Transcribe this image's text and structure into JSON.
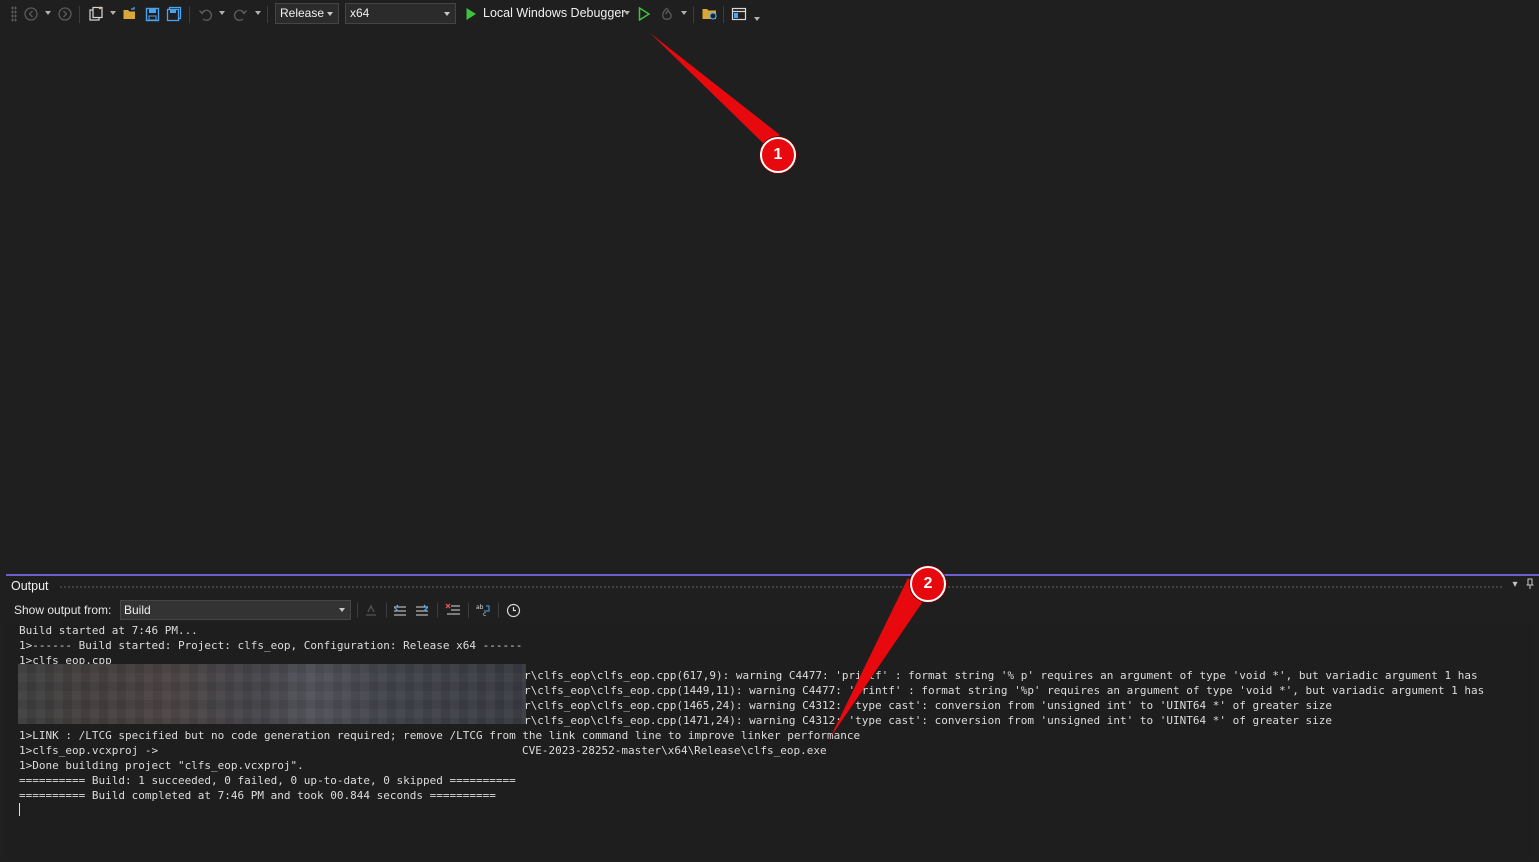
{
  "toolbar": {
    "configuration": "Release",
    "platform": "x64",
    "debugger_label": "Local Windows Debugger",
    "accent_run": "#3fc23f"
  },
  "output": {
    "title": "Output",
    "show_from_label": "Show output from:",
    "source": "Build",
    "lines": [
      "Build started at 7:46 PM...",
      "1>------ Build started: Project: clfs_eop, Configuration: Release x64 ------",
      "1>clfs_eop.cpp",
      "r\\clfs_eop\\clfs_eop.cpp(617,9): warning C4477: 'printf' : format string '% p' requires an argument of type 'void *', but variadic argument 1 has",
      "r\\clfs_eop\\clfs_eop.cpp(1449,11): warning C4477: 'printf' : format string '%p' requires an argument of type 'void *', but variadic argument 1 has",
      "r\\clfs_eop\\clfs_eop.cpp(1465,24): warning C4312: 'type cast': conversion from 'unsigned int' to 'UINT64 *' of greater size",
      "r\\clfs_eop\\clfs_eop.cpp(1471,24): warning C4312: 'type cast': conversion from 'unsigned int' to 'UINT64 *' of greater size",
      "1>LINK : /LTCG specified but no code generation required; remove /LTCG from the link command line to improve linker performance",
      "1>clfs_eop.vcxproj ->",
      "CVE-2023-28252-master\\x64\\Release\\clfs_eop.exe",
      "1>Done building project \"clfs_eop.vcxproj\".",
      "========== Build: 1 succeeded, 0 failed, 0 up-to-date, 0 skipped ==========",
      "========== Build completed at 7:46 PM and took 00.844 seconds =========="
    ]
  },
  "annotations": {
    "marker_1": "1",
    "marker_2": "2",
    "color": "#e8090e"
  }
}
